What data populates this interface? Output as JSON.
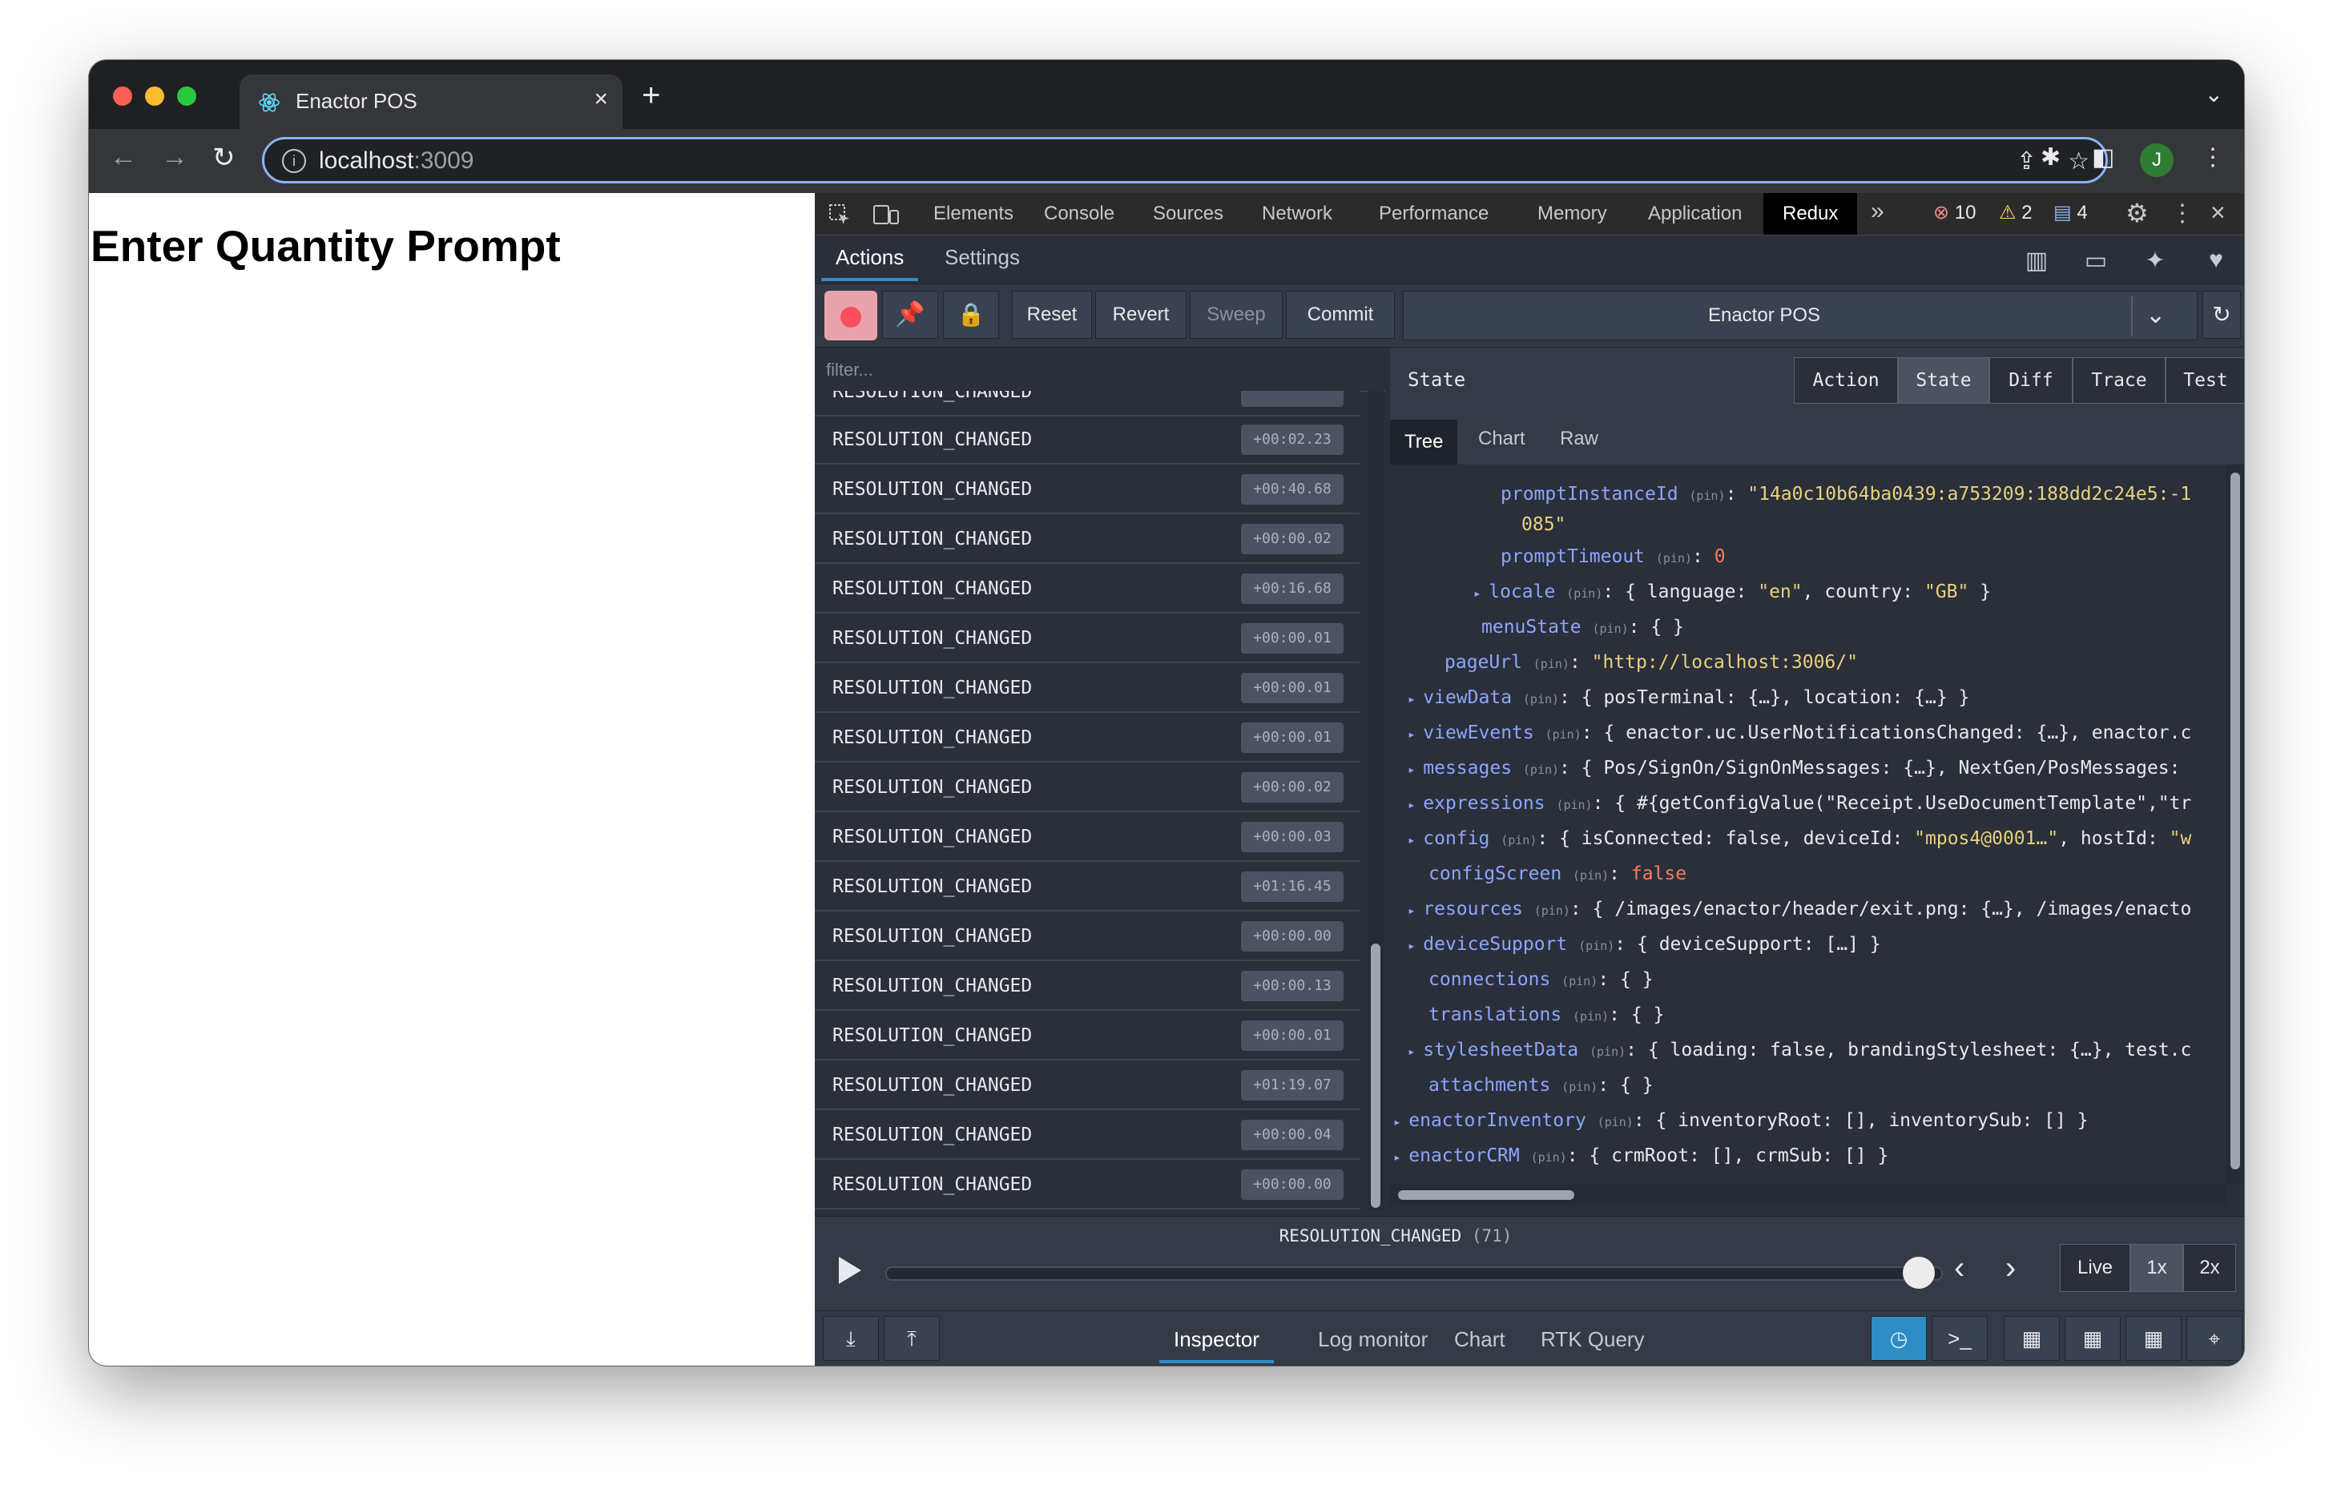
{
  "browser": {
    "tab_title": "Enactor POS",
    "new_tab_label": "+",
    "url_host": "localhost",
    "url_port": ":3009",
    "avatar_letter": "J",
    "colors": {
      "tab_bg": "#35363a",
      "omnibox_border": "#8ab4f8",
      "avatar": "#2e7d32"
    }
  },
  "page": {
    "heading": "Enter Quantity Prompt"
  },
  "devtools": {
    "tabs": [
      "Elements",
      "Console",
      "Sources",
      "Network",
      "Performance",
      "Memory",
      "Application",
      "Redux"
    ],
    "selected_tab": "Redux",
    "more_tabs": "»",
    "errors_count": "10",
    "warnings_count": "2",
    "messages_count": "4"
  },
  "redux": {
    "header_tabs": {
      "actions": "Actions",
      "settings": "Settings"
    },
    "toolbar": {
      "reset": "Reset",
      "revert": "Revert",
      "sweep": "Sweep",
      "commit": "Commit"
    },
    "instance": "Enactor POS",
    "filter_placeholder": "filter...",
    "actions": [
      {
        "name": "RESOLUTION_CHANGED",
        "time": "+00:02.23"
      },
      {
        "name": "RESOLUTION_CHANGED",
        "time": "+00:40.68"
      },
      {
        "name": "RESOLUTION_CHANGED",
        "time": "+00:00.02"
      },
      {
        "name": "RESOLUTION_CHANGED",
        "time": "+00:16.68"
      },
      {
        "name": "RESOLUTION_CHANGED",
        "time": "+00:00.01"
      },
      {
        "name": "RESOLUTION_CHANGED",
        "time": "+00:00.01"
      },
      {
        "name": "RESOLUTION_CHANGED",
        "time": "+00:00.01"
      },
      {
        "name": "RESOLUTION_CHANGED",
        "time": "+00:00.02"
      },
      {
        "name": "RESOLUTION_CHANGED",
        "time": "+00:00.03"
      },
      {
        "name": "RESOLUTION_CHANGED",
        "time": "+01:16.45"
      },
      {
        "name": "RESOLUTION_CHANGED",
        "time": "+00:00.00"
      },
      {
        "name": "RESOLUTION_CHANGED",
        "time": "+00:00.13"
      },
      {
        "name": "RESOLUTION_CHANGED",
        "time": "+00:00.01"
      },
      {
        "name": "RESOLUTION_CHANGED",
        "time": "+01:19.07"
      },
      {
        "name": "RESOLUTION_CHANGED",
        "time": "+00:00.04"
      },
      {
        "name": "RESOLUTION_CHANGED",
        "time": "+00:00.00"
      }
    ],
    "partial_top_action": "RESOLUTION_CHANGED",
    "state_label": "State",
    "view_tabs": [
      "Action",
      "State",
      "Diff",
      "Trace",
      "Test"
    ],
    "selected_view": "State",
    "sub_tabs": [
      "Tree",
      "Chart",
      "Raw"
    ],
    "selected_sub": "Tree",
    "pin": "(pin)",
    "tree": [
      {
        "arrow": "",
        "key": "promptInstanceId",
        "sep": ": ",
        "parts": [
          {
            "t": "\"14a0c10b64ba0439:a753209:188dd2c24e5:-1",
            "c": "s"
          }
        ]
      },
      {
        "arrow": "",
        "key": "",
        "sep": "",
        "parts": [
          {
            "t": "085\"",
            "c": "s"
          }
        ]
      },
      {
        "arrow": "",
        "key": "promptTimeout",
        "sep": ": ",
        "parts": [
          {
            "t": "0",
            "c": "n"
          }
        ]
      },
      {
        "arrow": "▸",
        "key": "locale",
        "sep": ": ",
        "parts": [
          {
            "t": "{ language: ",
            "c": ""
          },
          {
            "t": "\"en\"",
            "c": "s"
          },
          {
            "t": ", country: ",
            "c": ""
          },
          {
            "t": "\"GB\"",
            "c": "s"
          },
          {
            "t": " }",
            "c": ""
          }
        ]
      },
      {
        "arrow": "",
        "key": "menuState",
        "sep": ": ",
        "parts": [
          {
            "t": "{ }",
            "c": ""
          }
        ]
      },
      {
        "arrow": "",
        "key": "pageUrl",
        "sep": ": ",
        "parts": [
          {
            "t": "\"http://localhost:3006/\"",
            "c": "s"
          }
        ]
      },
      {
        "arrow": "▸",
        "key": "viewData",
        "sep": ": ",
        "parts": [
          {
            "t": "{ posTerminal: {…}, location: {…} }",
            "c": ""
          }
        ]
      },
      {
        "arrow": "▸",
        "key": "viewEvents",
        "sep": ": ",
        "parts": [
          {
            "t": "{ enactor.uc.UserNotificationsChanged: {…}, enactor.c",
            "c": ""
          }
        ]
      },
      {
        "arrow": "▸",
        "key": "messages",
        "sep": ": ",
        "parts": [
          {
            "t": "{ Pos/SignOn/SignOnMessages: {…}, NextGen/PosMessages: ",
            "c": ""
          }
        ]
      },
      {
        "arrow": "▸",
        "key": "expressions",
        "sep": ": ",
        "parts": [
          {
            "t": "{ #{getConfigValue(\"Receipt.UseDocumentTemplate\",\"tr",
            "c": ""
          }
        ]
      },
      {
        "arrow": "▸",
        "key": "config",
        "sep": ": ",
        "parts": [
          {
            "t": "{ isConnected: false, deviceId: ",
            "c": ""
          },
          {
            "t": "\"mpos4@0001…\"",
            "c": "s"
          },
          {
            "t": ", hostId: ",
            "c": ""
          },
          {
            "t": "\"w",
            "c": "s"
          }
        ]
      },
      {
        "arrow": "",
        "key": "configScreen",
        "sep": ": ",
        "parts": [
          {
            "t": "false",
            "c": "b"
          }
        ]
      },
      {
        "arrow": "▸",
        "key": "resources",
        "sep": ": ",
        "parts": [
          {
            "t": "{ /images/enactor/header/exit.png: {…}, /images/enacto",
            "c": ""
          }
        ]
      },
      {
        "arrow": "▸",
        "key": "deviceSupport",
        "sep": ": ",
        "parts": [
          {
            "t": "{ deviceSupport: […] }",
            "c": ""
          }
        ]
      },
      {
        "arrow": "",
        "key": "connections",
        "sep": ": ",
        "parts": [
          {
            "t": "{ }",
            "c": ""
          }
        ]
      },
      {
        "arrow": "",
        "key": "translations",
        "sep": ": ",
        "parts": [
          {
            "t": "{ }",
            "c": ""
          }
        ]
      },
      {
        "arrow": "▸",
        "key": "stylesheetData",
        "sep": ": ",
        "parts": [
          {
            "t": "{ loading: false, brandingStylesheet: {…}, test.c",
            "c": ""
          }
        ]
      },
      {
        "arrow": "",
        "key": "attachments",
        "sep": ": ",
        "parts": [
          {
            "t": "{ }",
            "c": ""
          }
        ]
      },
      {
        "arrow": "▸",
        "key": "enactorInventory",
        "sep": ": ",
        "parts": [
          {
            "t": "{ inventoryRoot: [], inventorySub: [] }",
            "c": ""
          }
        ]
      },
      {
        "arrow": "▸",
        "key": "enactorCRM",
        "sep": ": ",
        "parts": [
          {
            "t": "{ crmRoot: [], crmSub: [] }",
            "c": ""
          }
        ]
      }
    ],
    "slider": {
      "action": "RESOLUTION_CHANGED",
      "count": "(71)",
      "position_fraction": 0.98
    },
    "speeds": [
      "Live",
      "1x",
      "2x"
    ],
    "selected_speed": "1x",
    "monitors": [
      "Inspector",
      "Log monitor",
      "Chart",
      "RTK Query"
    ],
    "selected_monitor": "Inspector",
    "colors": {
      "bg": "#2a2f3a",
      "accent": "#2d8dc4",
      "key": "#8da6ff",
      "string": "#e8d27a",
      "number": "#ff7a5c"
    }
  }
}
